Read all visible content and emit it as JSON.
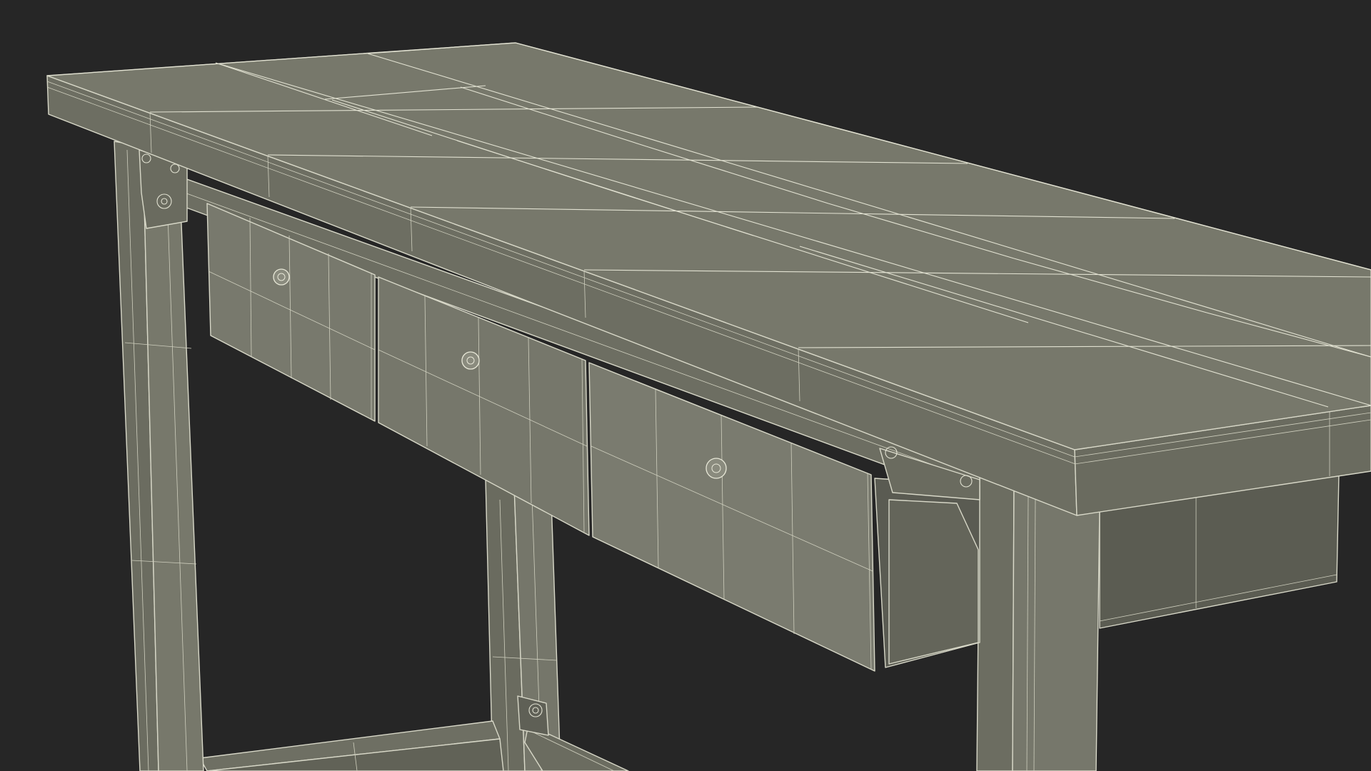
{
  "scene": {
    "subject": "workbench-wireframe",
    "colors": {
      "background": "#262626",
      "top_surface": "#77786a",
      "top_edge": "#6c6d61",
      "apron": "#6f7064",
      "drawer": "#77786c",
      "leg": "#727366",
      "shadow": "#55564d",
      "wire": "#e2e2d2"
    },
    "drawer_count": 3,
    "icons": [
      "drawer-knob-icon",
      "bracket-icon"
    ]
  }
}
